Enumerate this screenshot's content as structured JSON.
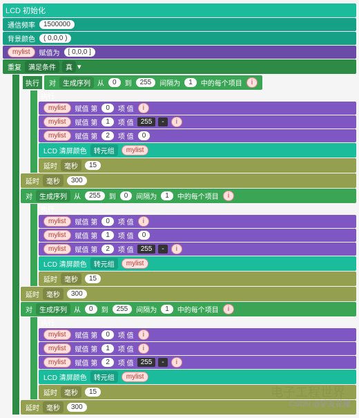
{
  "lcd_init": "LCD 初始化",
  "freq_label": "通信频率",
  "freq_val": "1500000",
  "bgcolor_label": "背景颜色",
  "bgcolor_val": "( 0,0,0 )",
  "mylist": "mylist",
  "assign": "赋值为",
  "mylist_init": "[ 0,0,0 ]",
  "repeat": "重复",
  "condition": "满足条件",
  "true": "真",
  "exec": "执行",
  "for": "对",
  "seq": "生成序列",
  "from": "从",
  "to": "到",
  "step": "间隔为",
  "each": "中的每个项目",
  "i": "i",
  "assign_idx": "赋值 第",
  "item": "项 值",
  "lcd_clear": "LCD 清屏颜色",
  "to_tuple": "转元组",
  "delay": "延时",
  "ms": "毫秒",
  "minus": "-",
  "n0": "0",
  "n1": "1",
  "n2": "2",
  "n15": "15",
  "n255": "255",
  "n300": "300",
  "watermark": "CSDN @驴友花雕",
  "bg_watermark": "电子工程世界"
}
